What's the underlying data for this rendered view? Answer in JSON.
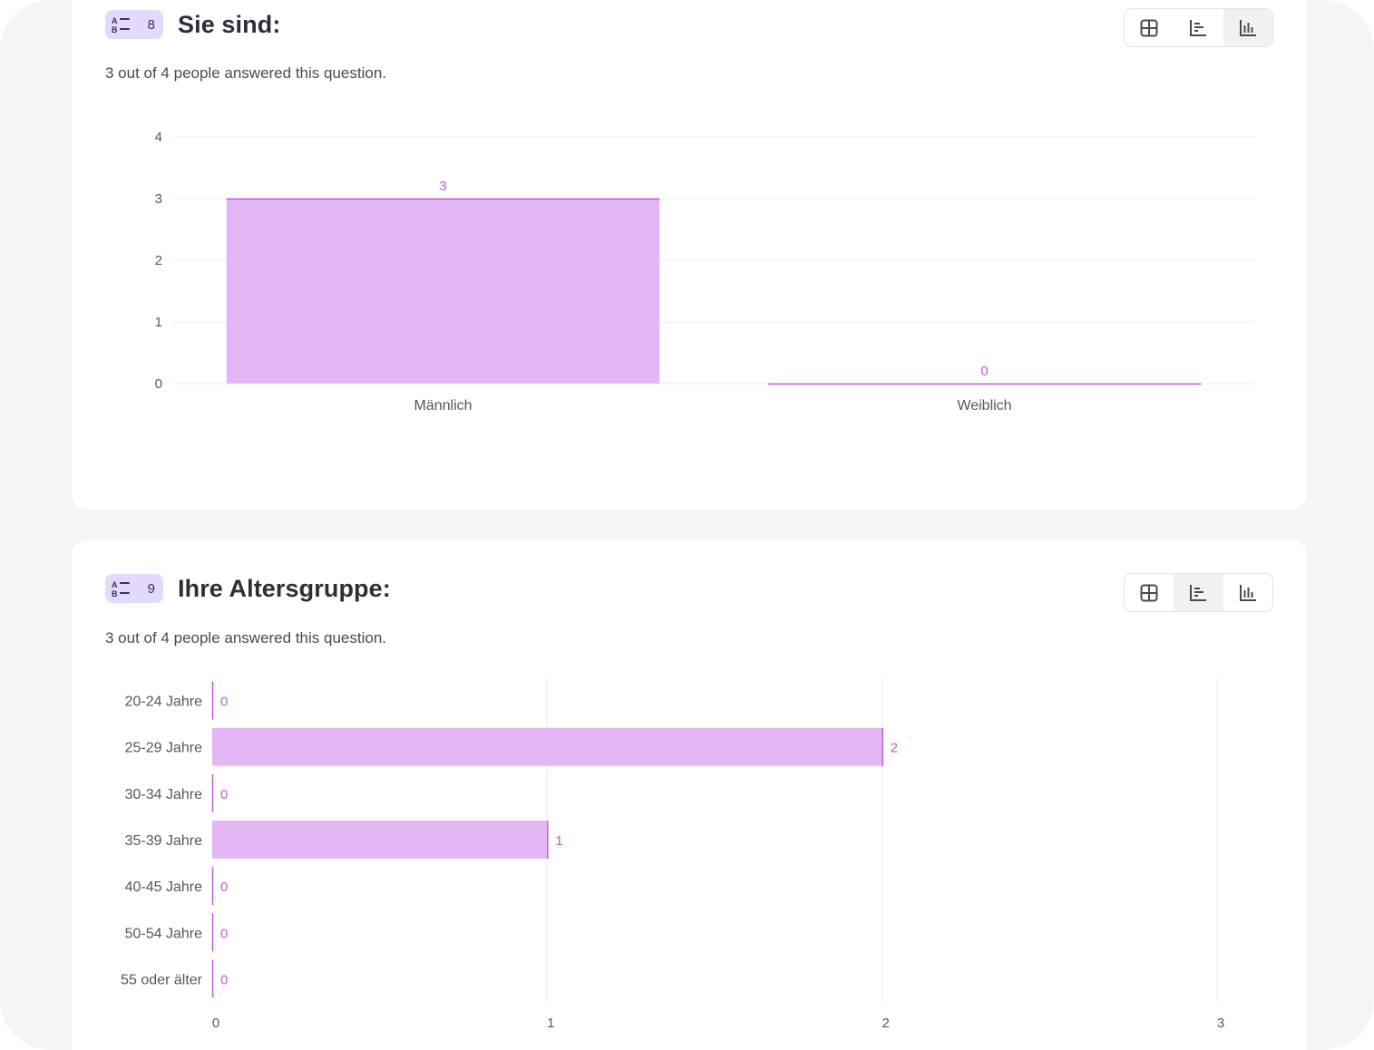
{
  "questions": [
    {
      "number": "8",
      "title": "Sie sind:",
      "answered_text": "3 out of 4 people answered this question.",
      "active_view": "vertical-bar",
      "chart_data": {
        "type": "bar",
        "orientation": "vertical",
        "categories": [
          "Männlich",
          "Weiblich"
        ],
        "values": [
          3,
          0
        ],
        "ylim": [
          0,
          4
        ],
        "yticks": [
          0,
          1,
          2,
          3,
          4
        ],
        "grid": true,
        "bar_color": "#e2b7f4",
        "label_color": "#c05ad6"
      }
    },
    {
      "number": "9",
      "title": "Ihre Altersgruppe:",
      "answered_text": "3 out of 4 people answered this question.",
      "active_view": "horizontal-bar",
      "chart_data": {
        "type": "bar",
        "orientation": "horizontal",
        "categories": [
          "20-24 Jahre",
          "25-29 Jahre",
          "30-34 Jahre",
          "35-39 Jahre",
          "40-45 Jahre",
          "50-54 Jahre",
          "55 oder älter"
        ],
        "values": [
          0,
          2,
          0,
          1,
          0,
          0,
          0
        ],
        "xlim": [
          0,
          3
        ],
        "xticks": [
          0,
          1,
          2,
          3
        ],
        "grid": true,
        "bar_color": "#e2b7f4",
        "label_color": "#c05ad6"
      }
    }
  ],
  "icons": {
    "question_type": "sort-list-icon",
    "table_view": "table-grid-icon",
    "horizontal_bar_view": "horizontal-bar-chart-icon",
    "vertical_bar_view": "vertical-bar-chart-icon"
  },
  "colors": {
    "background": "#f5f5f7",
    "card": "#ffffff",
    "badge": "#e3d9fb",
    "bar": "#e2b7f4",
    "accent": "#c05ad6"
  }
}
